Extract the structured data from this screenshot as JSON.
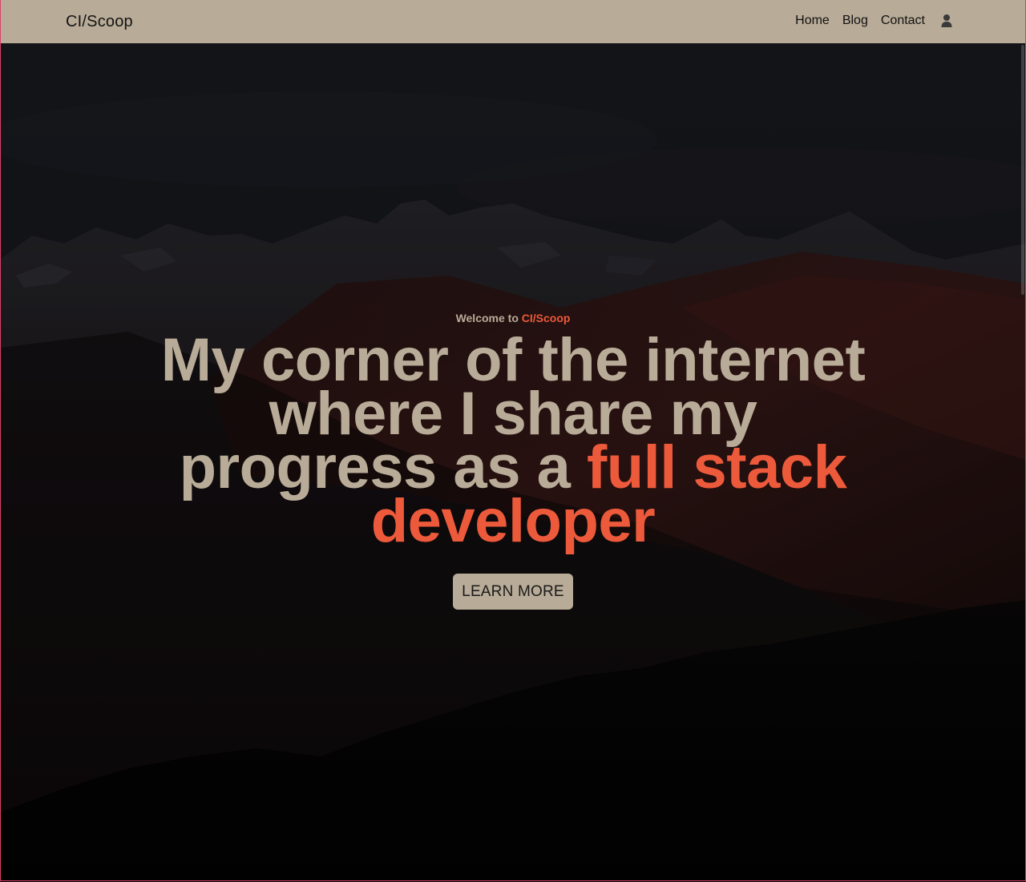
{
  "navbar": {
    "brand": "CI/Scoop",
    "links": [
      {
        "label": "Home"
      },
      {
        "label": "Blog"
      },
      {
        "label": "Contact"
      }
    ],
    "account_icon": "user-icon"
  },
  "hero": {
    "welcome_prefix": "Welcome to ",
    "welcome_accent": "CI/Scoop",
    "headline_plain": "My corner of the internet where I share my progress as a ",
    "headline_accent": "full stack developer",
    "cta_label": "LEARN MORE"
  },
  "colors": {
    "nav_background": "#b8ab97",
    "accent": "#ec5a3b",
    "headline_text": "#b8ab97",
    "hero_background": "#16171c"
  }
}
